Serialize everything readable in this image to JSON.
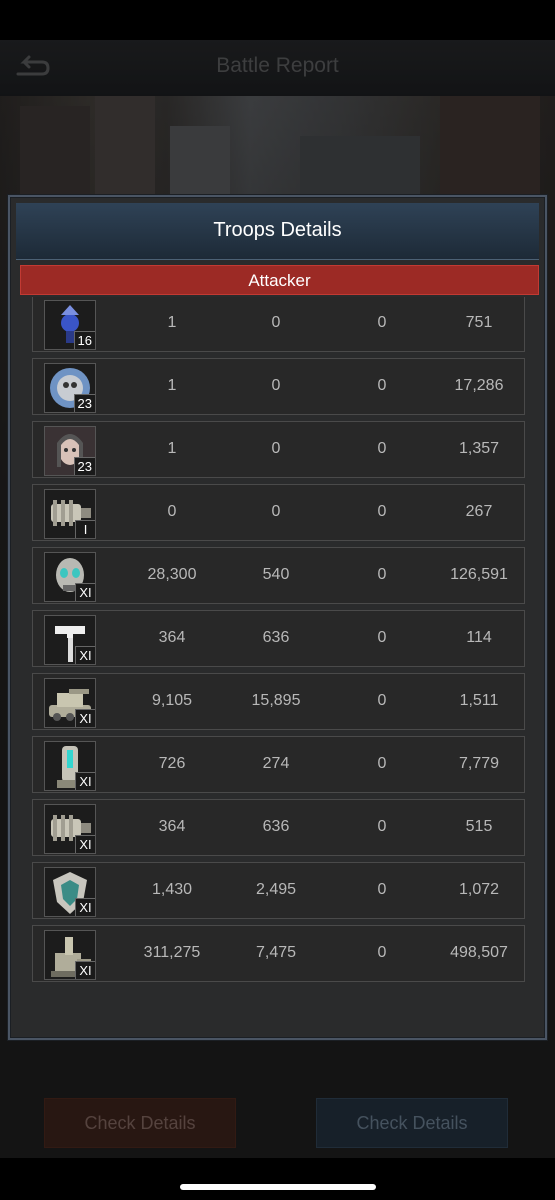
{
  "header": {
    "title": "Battle Report",
    "back_icon": "back-arrow-icon"
  },
  "modal": {
    "title": "Troops Details",
    "side_label": "Attacker",
    "side_color": "#9c2a25",
    "rows": [
      {
        "icon": "drone-swarm-icon",
        "level": "16",
        "values": [
          "1",
          "0",
          "0",
          "751"
        ]
      },
      {
        "icon": "planet-beast-icon",
        "level": "23",
        "values": [
          "1",
          "0",
          "0",
          "17,286"
        ]
      },
      {
        "icon": "female-hero-portrait-icon",
        "level": "23",
        "values": [
          "1",
          "0",
          "0",
          "1,357"
        ]
      },
      {
        "icon": "gatling-turret-icon",
        "level": "I",
        "values": [
          "0",
          "0",
          "0",
          "267"
        ]
      },
      {
        "icon": "skull-soldier-icon",
        "level": "XI",
        "values": [
          "28,300",
          "540",
          "0",
          "126,591"
        ]
      },
      {
        "icon": "hammer-axe-icon",
        "level": "XI",
        "values": [
          "364",
          "636",
          "0",
          "114"
        ]
      },
      {
        "icon": "tank-icon",
        "level": "XI",
        "values": [
          "9,105",
          "15,895",
          "0",
          "1,511"
        ]
      },
      {
        "icon": "rocket-launcher-icon",
        "level": "XI",
        "values": [
          "726",
          "274",
          "0",
          "7,779"
        ]
      },
      {
        "icon": "gatling-turret-icon",
        "level": "XI",
        "values": [
          "364",
          "636",
          "0",
          "515"
        ]
      },
      {
        "icon": "shield-emblem-icon",
        "level": "XI",
        "values": [
          "1,430",
          "2,495",
          "0",
          "1,072"
        ]
      },
      {
        "icon": "artillery-cannon-icon",
        "level": "XI",
        "values": [
          "311,275",
          "7,475",
          "0",
          "498,507"
        ]
      }
    ]
  },
  "footer": {
    "left_button": "Check Details",
    "right_button": "Check Details"
  }
}
